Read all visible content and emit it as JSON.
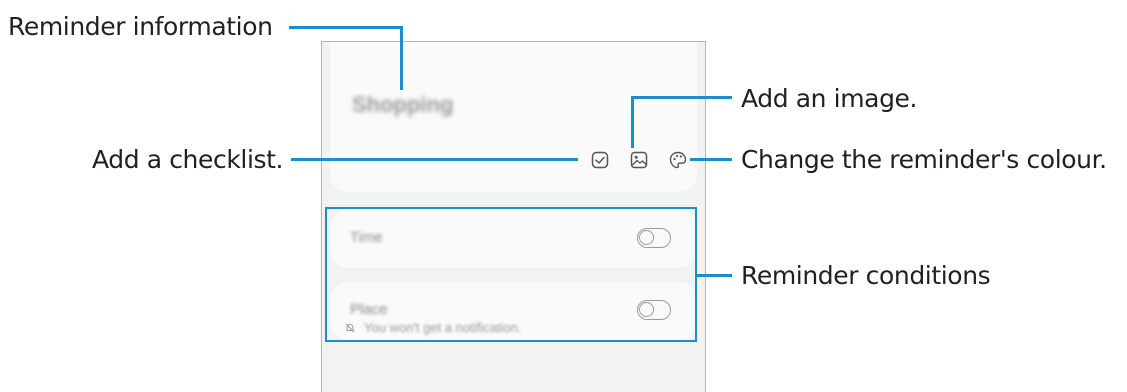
{
  "callouts": {
    "reminder_information": "Reminder information",
    "add_image": "Add an image.",
    "add_checklist": "Add a checklist.",
    "change_colour": "Change the reminder's colour.",
    "reminder_conditions": "Reminder conditions"
  },
  "phone": {
    "note_title": "Shopping",
    "conditions": [
      {
        "label": "Time",
        "enabled": false
      },
      {
        "label": "Place",
        "enabled": false
      }
    ],
    "notification_text": "You won't get a notification."
  },
  "colors": {
    "callout_line": "#1a8fc9",
    "background": "#f2f2f2",
    "card": "#fafafa"
  },
  "icons": [
    "checklist-icon",
    "image-icon",
    "palette-icon",
    "toggle-switch",
    "bell-off-icon"
  ]
}
